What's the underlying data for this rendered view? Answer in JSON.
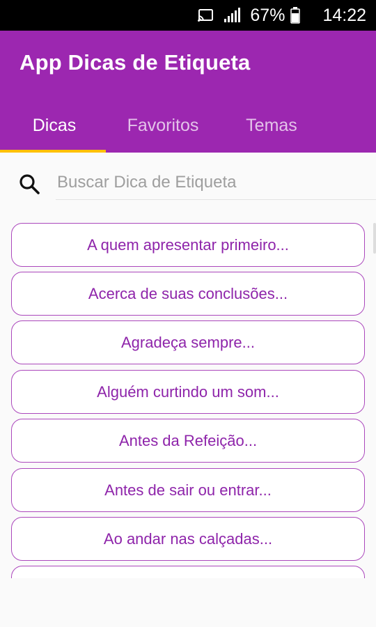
{
  "status_bar": {
    "battery_percent": "67%",
    "time": "14:22",
    "icons": [
      "cast-icon",
      "signal-icon",
      "battery-icon"
    ]
  },
  "app": {
    "title": "App Dicas de Etiqueta",
    "colors": {
      "primary": "#9c27b0",
      "indicator": "#ffc107",
      "accent_text": "#8e24aa"
    }
  },
  "tabs": [
    {
      "label": "Dicas",
      "active": true
    },
    {
      "label": "Favoritos",
      "active": false
    },
    {
      "label": "Temas",
      "active": false
    }
  ],
  "search": {
    "placeholder": "Buscar Dica de Etiqueta",
    "value": ""
  },
  "tips": [
    "A quem apresentar primeiro...",
    "Acerca de suas conclusões...",
    "Agradeça sempre...",
    "Alguém curtindo um som...",
    "Antes da Refeição...",
    "Antes de sair ou entrar...",
    "Ao andar nas calçadas..."
  ]
}
